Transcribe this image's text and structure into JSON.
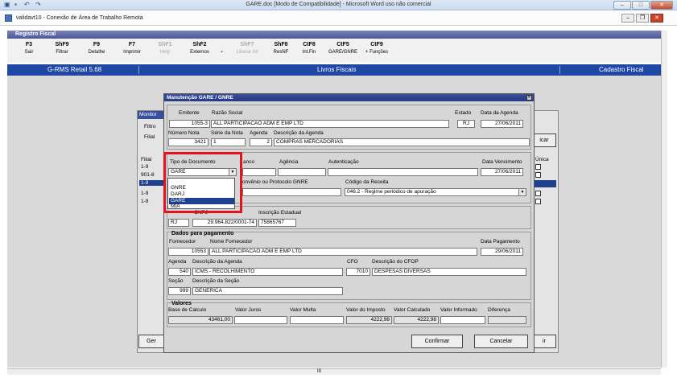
{
  "word": {
    "title": "GARE.doc [Modo de Compatibilidade] - Microsoft Word uso não comercial"
  },
  "rdp": {
    "title": "validavt10 - Conexão de Área de Trabalho Remota"
  },
  "app": {
    "module_title": "Registro Fiscal",
    "fkeys": [
      {
        "key": "F3",
        "label": "Sair",
        "enabled": true
      },
      {
        "key": "ShF9",
        "label": "Filtrar",
        "enabled": true
      },
      {
        "key": "F9",
        "label": "Detalhe",
        "enabled": true
      },
      {
        "key": "F7",
        "label": "Imprimir",
        "enabled": true
      },
      {
        "key": "ShF1",
        "label": "Help",
        "enabled": false
      },
      {
        "key": "ShF2",
        "label": "Externos",
        "enabled": true
      },
      {
        "key": "ShF7",
        "label": "Liberar Alt",
        "enabled": false
      },
      {
        "key": "ShF8",
        "label": "ResNF",
        "enabled": true
      },
      {
        "key": "CtF8",
        "label": "Int.Fin",
        "enabled": true
      },
      {
        "key": "CtF5",
        "label": "GARE/GNRE",
        "enabled": true
      },
      {
        "key": "CtF9",
        "label": "+ Funções",
        "enabled": true
      }
    ],
    "status": {
      "product": "G-RMS Retail 5.68",
      "section": "Livros Fiscais",
      "screen": "Cadastro Fiscal"
    }
  },
  "bg": {
    "title": "Monitor",
    "filtro_label": "Filtro",
    "filial_label": "Filial",
    "col_filial": "Filial",
    "col_unica": "Única",
    "rows": [
      "1-9",
      "901-8",
      "1-9",
      "1-9",
      "1-9"
    ],
    "btn_left": "Ger",
    "btn_right": "ir",
    "btn_top_right": "icar"
  },
  "dialog": {
    "title": "Manutenção GARE / GNRE",
    "emitente_label": "Emitente",
    "emitente": "1055-3",
    "razao_label": "Razão Social",
    "razao": "ALL PARTICIPACAO ADM E EMP LTD",
    "estado_label": "Estado",
    "estado": "RJ",
    "data_agenda_label": "Data da Agenda",
    "data_agenda": "27/06/2011",
    "numero_nota_label": "Número Nota",
    "numero_nota": "3421",
    "serie_label": "Série da Nota",
    "serie": "1",
    "agenda_label": "Agenda",
    "agenda": "2",
    "desc_agenda_label": "Descrição da Agenda",
    "desc_agenda": "COMPRAS MERCADORIAS",
    "tipo_doc_label": "Tipo de Documento",
    "tipo_doc": "GARE",
    "banco_label": "anco",
    "agencia_label": "Agência",
    "autenticacao_label": "Autenticação",
    "data_venc_label": "Data Vencimento",
    "data_venc": "27/06/2011",
    "convenio_label": "onvênio ou Protocolo GNRE",
    "cod_receita_label": "Código da Receita",
    "cod_receita": "046.2 - Regime periódico de apuração",
    "cnpj_label": "CNPJ",
    "uf": "RJ",
    "cnpj": "29.964.822/0001-74",
    "ie_label": "Inscrição Estadual",
    "ie": "75865767",
    "pagamento_title": "Dados para pagamento",
    "fornecedor_label": "Fornecedor",
    "fornecedor": "10553",
    "nome_forn_label": "Nome Fornecedor",
    "nome_forn": "ALL PARTICIPACAO ADM E EMP LTD",
    "data_pag_label": "Data Pagamento",
    "data_pag": "29/06/2011",
    "agenda2_label": "Agenda",
    "agenda2": "540",
    "desc_agenda2_label": "Descrição da Agenda",
    "desc_agenda2": "ICMS - RECOLHIMENTO",
    "cfo_label": "CFO",
    "cfo": "7010",
    "desc_cfop_label": "Descrição do CFOP",
    "desc_cfop": "DESPESAS DIVERSAS",
    "secao_label": "Seção",
    "secao": "999",
    "desc_secao_label": "Descrição da Seção",
    "desc_secao": "GENERICA",
    "valores_title": "Valores",
    "base_label": "Base de Calculo",
    "base": "43461,00",
    "juros_label": "Valor Juros",
    "multa_label": "Valor Multa",
    "imposto_label": "Valor do Imposto",
    "imposto": "4222,98",
    "calculado_label": "Valor Calculado",
    "calculado": "4222,98",
    "informado_label": "Valor Informado",
    "diferenca_label": "Diferença",
    "confirm_label": "Confirmar",
    "cancel_label": "Cancelar",
    "dropdown_options": [
      "GNRE",
      "DARJ",
      "GARE",
      "MIA"
    ],
    "dropdown_selected": 2
  },
  "colors": {
    "accent_blue": "#1f47a4",
    "highlight": "#e3141c"
  }
}
